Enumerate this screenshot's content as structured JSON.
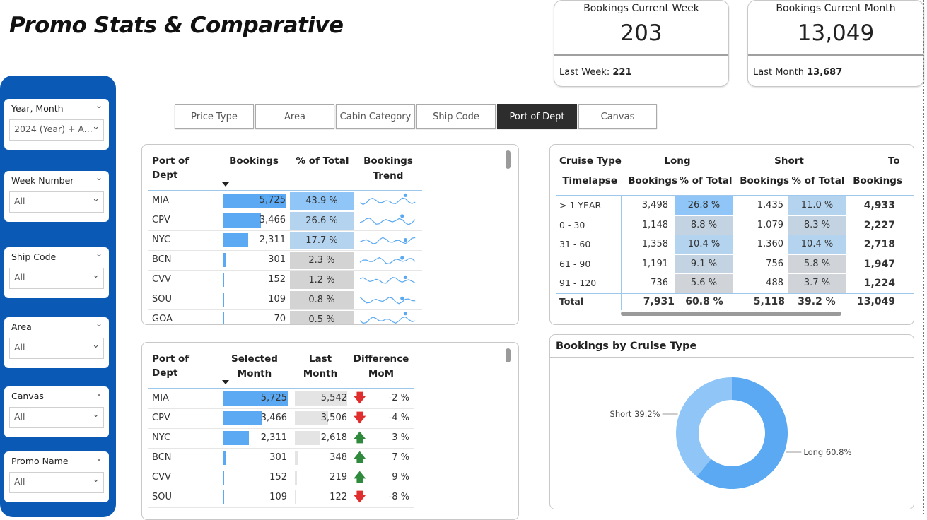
{
  "title": "Promo Stats & Comparative",
  "kpi_week": {
    "label": "Bookings Current Week",
    "value": "203",
    "foot_label": "Last Week:",
    "foot_value": "221"
  },
  "kpi_month": {
    "label": "Bookings Current Month",
    "value": "13,049",
    "foot_label": "Last Month",
    "foot_value": "13,687"
  },
  "slicers": [
    {
      "label": "Year, Month",
      "value": "2024 (Year) + A..."
    },
    {
      "label": "Week Number",
      "value": "All"
    },
    {
      "label": "Ship Code",
      "value": "All"
    },
    {
      "label": "Area",
      "value": "All"
    },
    {
      "label": "Canvas",
      "value": "All"
    },
    {
      "label": "Promo Name",
      "value": "All"
    }
  ],
  "tabs": [
    "Price Type",
    "Area",
    "Cabin Category",
    "Ship Code",
    "Port of Dept",
    "Canvas"
  ],
  "active_tab": "Port of Dept",
  "port_table": {
    "headers": {
      "port": "Port of Dept",
      "bookings": "Bookings",
      "pct": "% of Total",
      "trend_1": "Bookings",
      "trend_2": "Trend"
    },
    "rows": [
      {
        "port": "MIA",
        "bookings": "5,725",
        "value": 5725,
        "pct": "43.9 %",
        "pct_value": 43.9
      },
      {
        "port": "CPV",
        "bookings": "3,466",
        "value": 3466,
        "pct": "26.6 %",
        "pct_value": 26.6
      },
      {
        "port": "NYC",
        "bookings": "2,311",
        "value": 2311,
        "pct": "17.7 %",
        "pct_value": 17.7
      },
      {
        "port": "BCN",
        "bookings": "301",
        "value": 301,
        "pct": "2.3 %",
        "pct_value": 2.3
      },
      {
        "port": "CVV",
        "bookings": "152",
        "value": 152,
        "pct": "1.2 %",
        "pct_value": 1.2
      },
      {
        "port": "SOU",
        "bookings": "109",
        "value": 109,
        "pct": "0.8 %",
        "pct_value": 0.8
      },
      {
        "port": "GOA",
        "bookings": "70",
        "value": 70,
        "pct": "0.5 %",
        "pct_value": 0.5
      }
    ]
  },
  "mom_table": {
    "headers": {
      "port": "Port of Dept",
      "sel_1": "Selected",
      "sel_2": "Month",
      "last_1": "Last",
      "last_2": "Month",
      "diff_1": "Difference",
      "diff_2": "MoM"
    },
    "rows": [
      {
        "port": "MIA",
        "selected": "5,725",
        "sel_value": 5725,
        "last": "5,542",
        "last_value": 5542,
        "trend": "down",
        "diff": "-2 %"
      },
      {
        "port": "CPV",
        "selected": "3,466",
        "sel_value": 3466,
        "last": "3,506",
        "last_value": 3506,
        "trend": "down",
        "diff": "-4 %"
      },
      {
        "port": "NYC",
        "selected": "2,311",
        "sel_value": 2311,
        "last": "2,618",
        "last_value": 2618,
        "trend": "up",
        "diff": "3 %"
      },
      {
        "port": "BCN",
        "selected": "301",
        "sel_value": 301,
        "last": "348",
        "last_value": 348,
        "trend": "up",
        "diff": "7 %"
      },
      {
        "port": "CVV",
        "selected": "152",
        "sel_value": 152,
        "last": "219",
        "last_value": 219,
        "trend": "up",
        "diff": "9 %"
      },
      {
        "port": "SOU",
        "selected": "109",
        "sel_value": 109,
        "last": "122",
        "last_value": 122,
        "trend": "down",
        "diff": "-8 %"
      }
    ]
  },
  "cruise_matrix": {
    "header_row1": {
      "cruise_type": "Cruise Type",
      "long": "Long",
      "short": "Short",
      "total": "To"
    },
    "header_row2": {
      "timelapse": "Timelapse",
      "long_bookings": "Bookings",
      "long_pct": "% of Total",
      "short_bookings": "Bookings",
      "short_pct": "% of Total",
      "total_bookings": "Bookings"
    },
    "rows": [
      {
        "timelapse": "> 1 YEAR",
        "long_b": "3,498",
        "long_p": "26.8 %",
        "long_pv": 26.8,
        "short_b": "1,435",
        "short_p": "11.0 %",
        "short_pv": 11.0,
        "total": "4,933"
      },
      {
        "timelapse": "0 - 30",
        "long_b": "1,148",
        "long_p": "8.8 %",
        "long_pv": 8.8,
        "short_b": "1,079",
        "short_p": "8.3 %",
        "short_pv": 8.3,
        "total": "2,227"
      },
      {
        "timelapse": "31 - 60",
        "long_b": "1,358",
        "long_p": "10.4 %",
        "long_pv": 10.4,
        "short_b": "1,360",
        "short_p": "10.4 %",
        "short_pv": 10.4,
        "total": "2,718"
      },
      {
        "timelapse": "61 - 90",
        "long_b": "1,191",
        "long_p": "9.1 %",
        "long_pv": 9.1,
        "short_b": "756",
        "short_p": "5.8 %",
        "short_pv": 5.8,
        "total": "1,947"
      },
      {
        "timelapse": "91 - 120",
        "long_b": "736",
        "long_p": "5.6 %",
        "long_pv": 5.6,
        "short_b": "488",
        "short_p": "3.7 %",
        "short_pv": 3.7,
        "total": "1,224"
      }
    ],
    "total_row": {
      "label": "Total",
      "long_b": "7,931",
      "long_p": "60.8 %",
      "short_b": "5,118",
      "short_p": "39.2 %",
      "total": "13,049"
    }
  },
  "donut": {
    "title": "Bookings by Cruise Type",
    "slices": [
      {
        "label": "Long 60.8%",
        "value": 60.8,
        "color": "#5aa9f2"
      },
      {
        "label": "Short 39.2%",
        "value": 39.2,
        "color": "#8fc6f7"
      }
    ]
  },
  "chart_data": {
    "type": "pie",
    "title": "Bookings by Cruise Type",
    "categories": [
      "Long",
      "Short"
    ],
    "values": [
      60.8,
      39.2
    ]
  },
  "colors": {
    "accent_bar": "#5aa9f2",
    "panel": "#0a59b5",
    "down": "#e02d2d",
    "up": "#2f8a3e"
  }
}
